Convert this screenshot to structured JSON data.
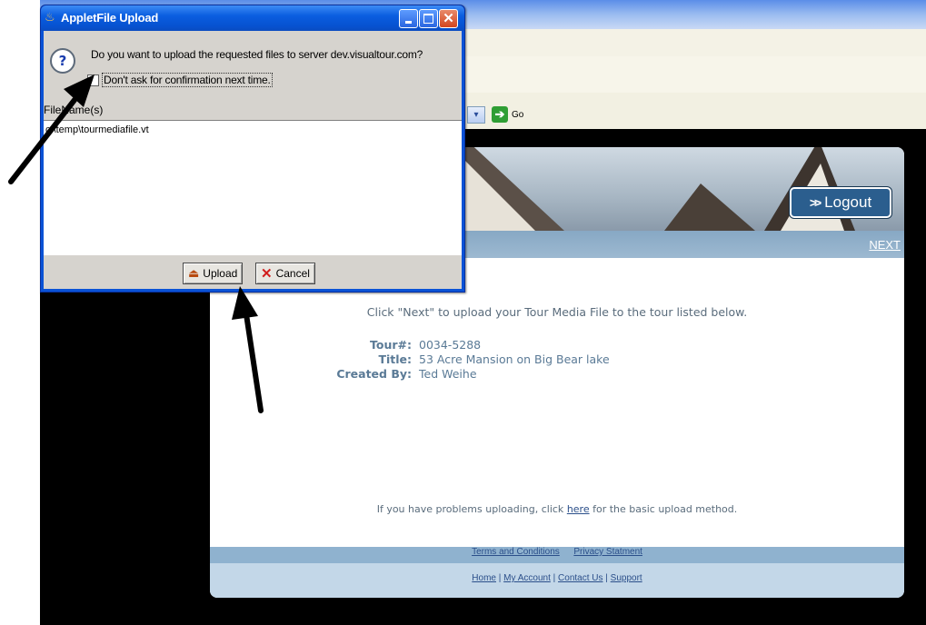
{
  "browser": {
    "go_label": "Go"
  },
  "page": {
    "logout_label": "Logout",
    "next_label": "NEXT",
    "instruction": "Click \"Next\" to upload your Tour Media File to the tour listed below.",
    "tour": {
      "number_label": "Tour#:",
      "number_value": "0034-5288",
      "title_label": "Title:",
      "title_value": "53 Acre Mansion on Big Bear lake",
      "created_by_label": "Created By:",
      "created_by_value": "Ted Weihe"
    },
    "problem_text_before": "If you have problems uploading, click",
    "problem_link": "here",
    "problem_text_after": "for the basic upload method.",
    "footer": {
      "terms": "Terms and Conditions",
      "privacy": "Privacy Statment",
      "home": "Home",
      "account": "My Account",
      "contact": "Contact Us",
      "support": "Support",
      "separator": "|"
    }
  },
  "dialog": {
    "title": "AppletFile Upload",
    "question": "Do you want to upload the requested files to server dev.visualtour.com?",
    "checkbox_label": "Don't ask for confirmation next time.",
    "filenames_label": "FileName(s)",
    "files": [
      "c:\\temp\\tourmediafile.vt"
    ],
    "upload_label": "Upload",
    "cancel_label": "Cancel"
  },
  "colors": {
    "dialog_titlebar": "#0a52d6",
    "nav_strip": "#87a8c4",
    "logout_button": "#2b5e8e",
    "text_blue": "#5a7a96"
  }
}
